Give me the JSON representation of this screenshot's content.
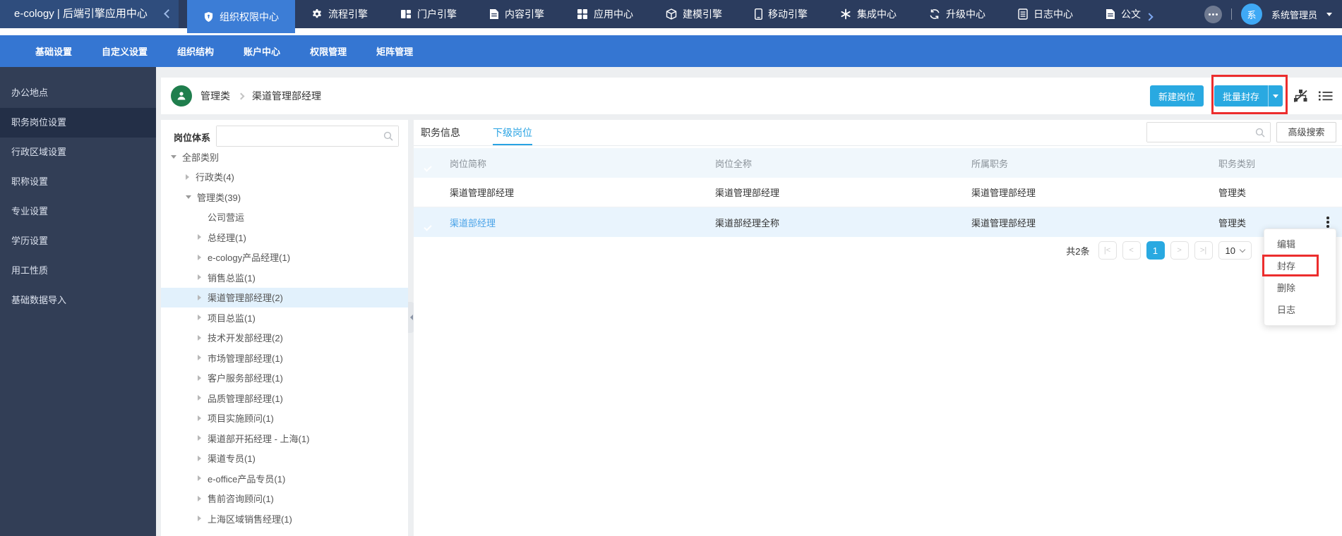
{
  "colors": {
    "topbar_bg": "#2b3c5e",
    "brand_bg": "#2f4d7d",
    "active_module_bg": "#3c7dd6",
    "subnav_bg": "#3576d2",
    "sidebar_bg": "#323e56",
    "sidebar_active_bg": "#232f47",
    "primary_button_blue": "#29a9e1",
    "tab_active_blue": "#29a3e3",
    "link_blue": "#4aa3e8",
    "row_selected_bg": "#e9f4fd",
    "tree_selected_bg": "#e2f1fc",
    "annotation_red": "#ec2d2d",
    "breadcrumb_icon_green": "#1f7e4d",
    "avatar_blue": "#3fa9f5"
  },
  "topnav": {
    "title": "e-cology | 后端引擎应用中心",
    "modules": [
      {
        "label": "组织权限中心",
        "icon": "shield-icon",
        "active": true
      },
      {
        "label": "流程引擎",
        "icon": "gear-icon"
      },
      {
        "label": "门户引擎",
        "icon": "portal-grid-icon"
      },
      {
        "label": "内容引擎",
        "icon": "document-icon"
      },
      {
        "label": "应用中心",
        "icon": "app-grid-icon"
      },
      {
        "label": "建模引擎",
        "icon": "cube-icon"
      },
      {
        "label": "移动引擎",
        "icon": "mobile-icon"
      },
      {
        "label": "集成中心",
        "icon": "integration-icon"
      },
      {
        "label": "升级中心",
        "icon": "upgrade-icon"
      },
      {
        "label": "日志中心",
        "icon": "log-icon"
      },
      {
        "label": "公文",
        "icon": "document-icon"
      }
    ],
    "user": {
      "avatar_text": "系",
      "name": "系统管理员"
    }
  },
  "subnav": {
    "items": [
      {
        "label": "基础设置"
      },
      {
        "label": "自定义设置"
      },
      {
        "label": "组织结构"
      },
      {
        "label": "账户中心"
      },
      {
        "label": "权限管理"
      },
      {
        "label": "矩阵管理"
      }
    ]
  },
  "sidebar": {
    "items": [
      {
        "label": "办公地点"
      },
      {
        "label": "职务岗位设置",
        "active": true
      },
      {
        "label": "行政区域设置"
      },
      {
        "label": "职称设置"
      },
      {
        "label": "专业设置"
      },
      {
        "label": "学历设置"
      },
      {
        "label": "用工性质"
      },
      {
        "label": "基础数据导入"
      }
    ]
  },
  "breadcrumb": {
    "category": "管理类",
    "current": "渠道管理部经理"
  },
  "toolbar": {
    "new_position_label": "新建岗位",
    "batch_archive_label": "批量封存"
  },
  "tree": {
    "panel_label": "岗位体系",
    "search_value": "",
    "items": [
      {
        "label": "全部类别",
        "level": 0,
        "state": "expanded"
      },
      {
        "label": "行政类(4)",
        "level": 1,
        "state": "collapsed"
      },
      {
        "label": "管理类(39)",
        "level": 1,
        "state": "expanded"
      },
      {
        "label": "公司营运",
        "level": 2,
        "state": "none"
      },
      {
        "label": "总经理(1)",
        "level": 2,
        "state": "collapsed"
      },
      {
        "label": "e-cology产品经理(1)",
        "level": 2,
        "state": "collapsed"
      },
      {
        "label": "销售总监(1)",
        "level": 2,
        "state": "collapsed"
      },
      {
        "label": "渠道管理部经理(2)",
        "level": 2,
        "state": "collapsed",
        "selected": true
      },
      {
        "label": "项目总监(1)",
        "level": 2,
        "state": "collapsed"
      },
      {
        "label": "技术开发部经理(2)",
        "level": 2,
        "state": "collapsed"
      },
      {
        "label": "市场管理部经理(1)",
        "level": 2,
        "state": "collapsed"
      },
      {
        "label": "客户服务部经理(1)",
        "level": 2,
        "state": "collapsed"
      },
      {
        "label": "品质管理部经理(1)",
        "level": 2,
        "state": "collapsed"
      },
      {
        "label": "项目实施顾问(1)",
        "level": 2,
        "state": "collapsed"
      },
      {
        "label": "渠道部开拓经理 - 上海(1)",
        "level": 2,
        "state": "collapsed"
      },
      {
        "label": "渠道专员(1)",
        "level": 2,
        "state": "collapsed"
      },
      {
        "label": "e-office产品专员(1)",
        "level": 2,
        "state": "collapsed"
      },
      {
        "label": "售前咨询顾问(1)",
        "level": 2,
        "state": "collapsed"
      },
      {
        "label": "上海区域销售经理(1)",
        "level": 2,
        "state": "collapsed"
      }
    ]
  },
  "tabs": {
    "info": "职务信息",
    "sub_positions": "下级岗位"
  },
  "list_search": {
    "value": "",
    "advanced_label": "高级搜索"
  },
  "table": {
    "columns": [
      "岗位简称",
      "岗位全称",
      "所属职务",
      "职务类别"
    ],
    "rows": [
      {
        "short_name": "渠道管理部经理",
        "full_name": "渠道管理部经理",
        "job": "渠道管理部经理",
        "category": "管理类",
        "checked": true
      },
      {
        "short_name": "渠道部经理",
        "full_name": "渠道部经理全称",
        "job": "渠道管理部经理",
        "category": "管理类",
        "checked": true,
        "selected": true
      }
    ]
  },
  "pagination": {
    "total_text": "共2条",
    "first": "|<",
    "prev": "<",
    "page": "1",
    "next": ">",
    "last": ">|",
    "page_size": "10"
  },
  "context_menu": {
    "items": [
      {
        "label": "编辑"
      },
      {
        "label": "封存",
        "highlighted": true
      },
      {
        "label": "删除"
      },
      {
        "label": "日志"
      }
    ]
  }
}
